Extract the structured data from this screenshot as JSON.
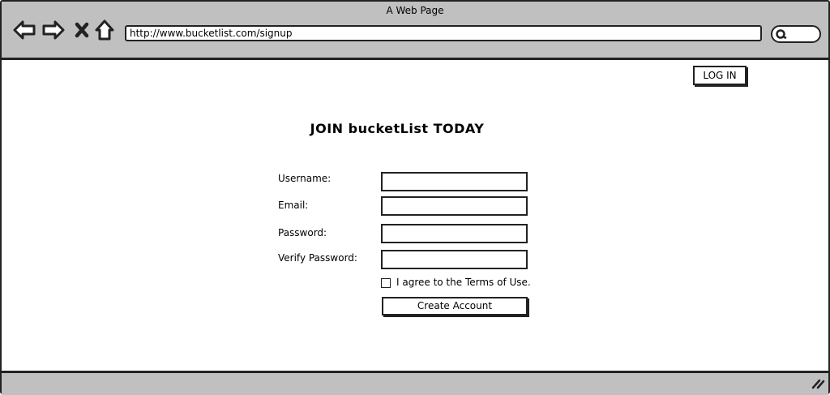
{
  "browser": {
    "window_title": "A Web Page",
    "url": "http://www.bucketlist.com/signup",
    "icons": [
      "back-arrow-icon",
      "forward-arrow-icon",
      "close-x-icon",
      "home-icon",
      "search-icon",
      "resize-grip-icon"
    ]
  },
  "header": {
    "login_label": "LOG IN"
  },
  "main": {
    "heading": "JOIN bucketList TODAY",
    "fields": [
      {
        "label": "Username:",
        "value": ""
      },
      {
        "label": "Email:",
        "value": ""
      },
      {
        "label": "Password:",
        "value": ""
      },
      {
        "label": "Verify Password:",
        "value": ""
      }
    ],
    "terms_label": "I agree to the Terms of Use.",
    "terms_checked": false,
    "submit_label": "Create Account"
  }
}
